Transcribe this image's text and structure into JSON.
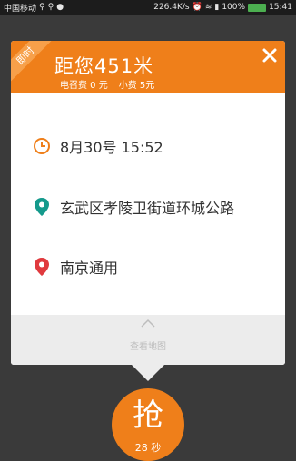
{
  "status_bar": {
    "carrier": "中国移动",
    "net_speed": "226.4K/s",
    "battery": "100%",
    "time": "15:41"
  },
  "order": {
    "badge": "即时",
    "distance": "距您451米",
    "call_fee": "电召费 0 元",
    "tip": "小费 5元",
    "time": "8月30号 15:52",
    "from": "玄武区孝陵卫街道环城公路",
    "to": "南京通用",
    "map_label": "查看地图",
    "grab_label": "抢",
    "countdown": "28 秒"
  },
  "colors": {
    "accent": "#ef7f1a",
    "start_pin": "#159a8c",
    "end_pin": "#e03a3e",
    "overlay": "#3a3a3a"
  }
}
